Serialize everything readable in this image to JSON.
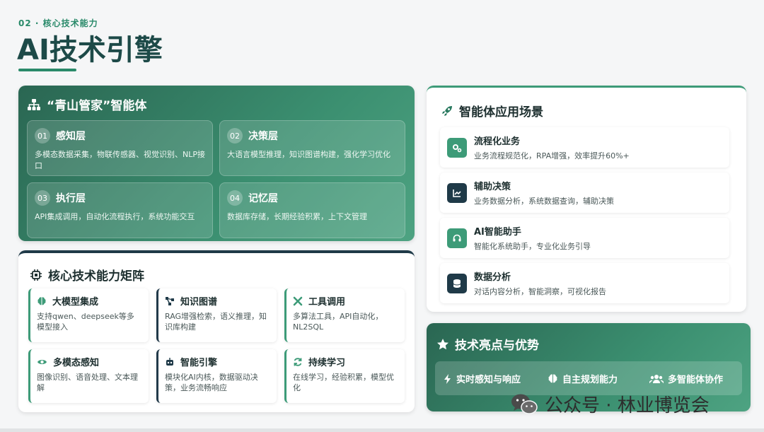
{
  "header": {
    "eyebrow": "02 · 核心技术能力",
    "title": "AI技术引擎"
  },
  "agent": {
    "title": "“青山管家”智能体",
    "icon": "sitemap-icon",
    "layers": [
      {
        "num": "01",
        "name": "感知层",
        "desc": "多模态数据采集，物联传感器、视觉识别、NLP接口"
      },
      {
        "num": "02",
        "name": "决策层",
        "desc": "大语言模型推理，知识图谱构建，强化学习优化"
      },
      {
        "num": "03",
        "name": "执行层",
        "desc": "API集成调用，自动化流程执行，系统功能交互"
      },
      {
        "num": "04",
        "name": "记忆层",
        "desc": "数据库存储，长期经验积累，上下文管理"
      }
    ]
  },
  "matrix": {
    "title": "核心技术能力矩阵",
    "icon": "chip-icon",
    "items": [
      {
        "name": "大模型集成",
        "desc": "支持qwen、deepseek等多模型接入",
        "icon": "brain-icon"
      },
      {
        "name": "知识图谱",
        "desc": "RAG增强检索，语义推理，知识库构建",
        "icon": "graph-icon"
      },
      {
        "name": "工具调用",
        "desc": "多算法工具，API自动化，NL2SQL",
        "icon": "tools-icon"
      },
      {
        "name": "多模态感知",
        "desc": "图像识别、语音处理、文本理解",
        "icon": "eye-icon"
      },
      {
        "name": "智能引擎",
        "desc": "模块化AI内核，数据驱动决策，业务流畅响应",
        "icon": "robot-icon"
      },
      {
        "name": "持续学习",
        "desc": "在线学习，经验积累，模型优化",
        "icon": "sync-icon"
      }
    ]
  },
  "scenarios": {
    "title": "智能体应用场景",
    "icon": "rocket-icon",
    "items": [
      {
        "name": "流程化业务",
        "desc": "业务流程规范化，RPA增强，效率提升60%+",
        "icon": "gears-icon"
      },
      {
        "name": "辅助决策",
        "desc": "业务数据分析，系统数据查询，辅助决策",
        "icon": "line-chart-icon"
      },
      {
        "name": "AI智能助手",
        "desc": "智能化系统助手，专业化业务引导",
        "icon": "headset-icon"
      },
      {
        "name": "数据分析",
        "desc": "对话内容分析，智能洞察，可视化报告",
        "icon": "database-icon"
      }
    ]
  },
  "highlights": {
    "title": "技术亮点与优势",
    "icon": "star-icon",
    "items": [
      {
        "label": "实时感知与响应",
        "icon": "bolt-icon"
      },
      {
        "label": "自主规划能力",
        "icon": "brain-icon"
      },
      {
        "label": "多智能体协作",
        "icon": "users-icon"
      }
    ]
  },
  "watermark": {
    "text": "公众号 · 林业博览会",
    "icon": "wechat-icon"
  },
  "colors": {
    "accent": "#3d9b78",
    "dark": "#1f3a48",
    "title": "#1d4a48"
  }
}
